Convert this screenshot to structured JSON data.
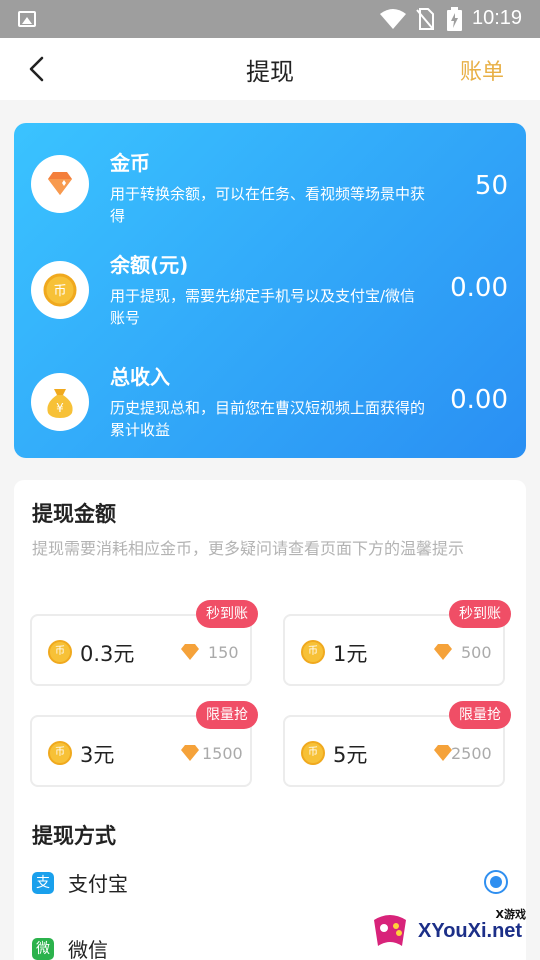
{
  "status_bar": {
    "time": "10:19"
  },
  "header": {
    "title": "提现",
    "bill": "账单"
  },
  "summary": [
    {
      "label": "金币",
      "desc": "用于转换余额，可以在任务、看视频等场景中获得",
      "value": "50",
      "icon": "diamond-icon"
    },
    {
      "label": "余额(元)",
      "desc": "用于提现，需要先绑定手机号以及支付宝/微信账号",
      "value": "0.00",
      "icon": "coin-icon"
    },
    {
      "label": "总收入",
      "desc": "历史提现总和，目前您在曹汉短视频上面获得的累计收益",
      "value": "0.00",
      "icon": "money-bag-icon"
    }
  ],
  "withdraw": {
    "title": "提现金额",
    "hint": "提现需要消耗相应金币，更多疑问请查看页面下方的温馨提示",
    "coin_glyph": "币",
    "options": [
      {
        "amount": "0.3元",
        "cost": "150",
        "badge": "秒到账"
      },
      {
        "amount": "1元",
        "cost": "500",
        "badge": "秒到账"
      },
      {
        "amount": "3元",
        "cost": "1500",
        "badge": "限量抢"
      },
      {
        "amount": "5元",
        "cost": "2500",
        "badge": "限量抢"
      }
    ]
  },
  "payment": {
    "title": "提现方式",
    "methods": [
      {
        "label": "支付宝",
        "glyph": "支",
        "selected": true
      },
      {
        "label": "微信",
        "glyph": "微",
        "selected": false
      }
    ]
  },
  "watermark": {
    "small": "X游戏",
    "big": "XYouXi.net"
  },
  "colors": {
    "accent": "#2f8ff0",
    "gold": "#e8b046",
    "badge": "#f04e66",
    "alipay": "#1aa0ec",
    "wechat": "#2bb24c"
  }
}
